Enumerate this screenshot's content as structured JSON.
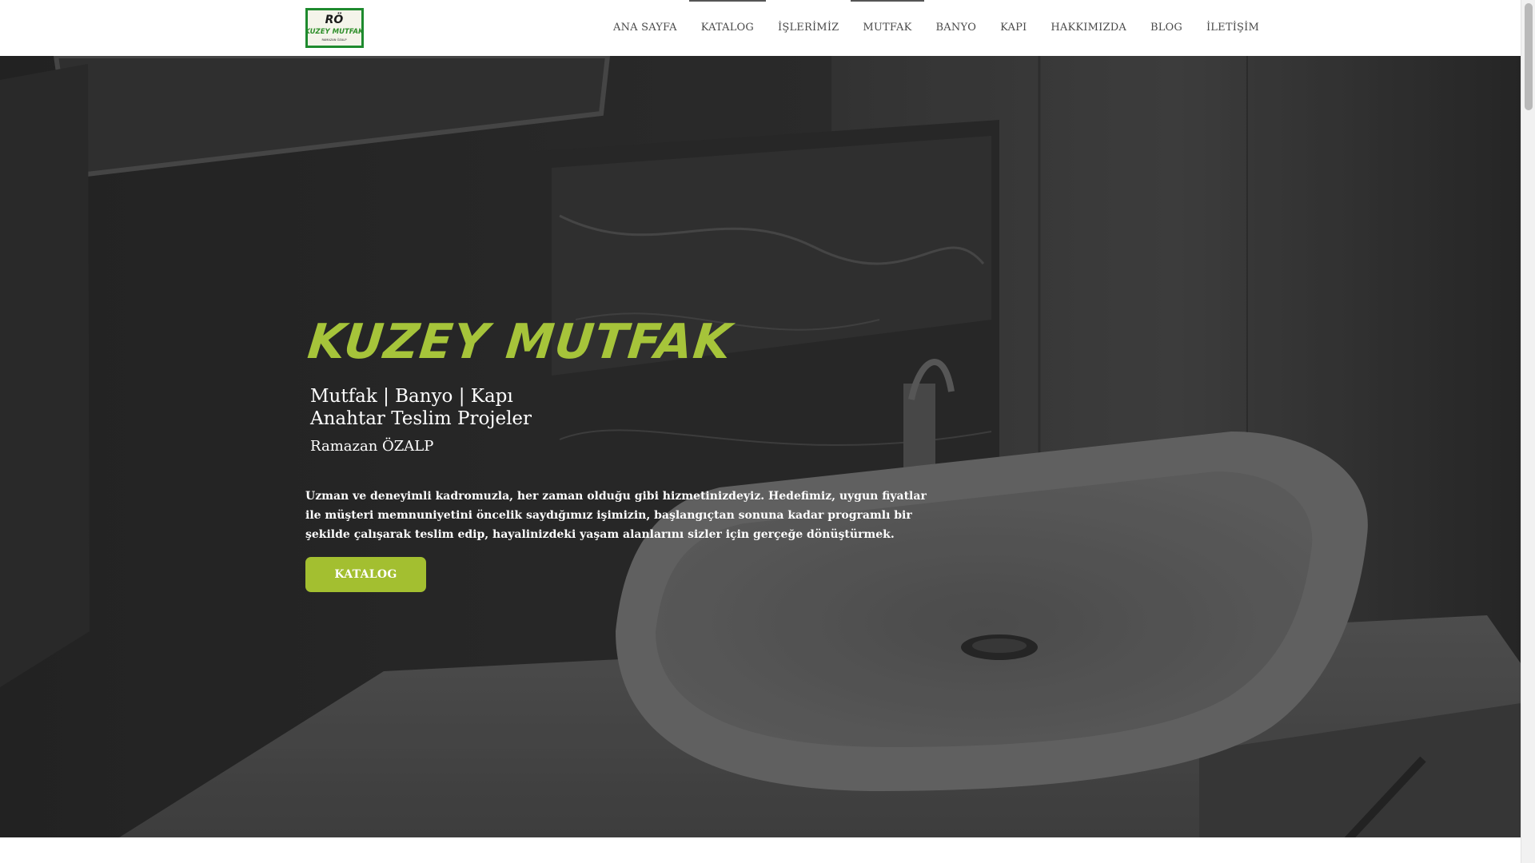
{
  "header": {
    "logo": {
      "line1": "RÖ",
      "line2": "KUZEY MUTFAK",
      "line3": "RAMAZAN ÖZALP"
    },
    "nav": [
      {
        "label": "ANA SAYFA"
      },
      {
        "label": "KATALOG"
      },
      {
        "label": "İŞLERİMİZ"
      },
      {
        "label": "MUTFAK"
      },
      {
        "label": "BANYO"
      },
      {
        "label": "KAPI"
      },
      {
        "label": "HAKKIMIZDA"
      },
      {
        "label": "BLOG"
      },
      {
        "label": "İLETİŞİM"
      }
    ]
  },
  "hero": {
    "brand_title": "KUZEY MUTFAK",
    "services_line1": "Mutfak | Banyo | Kapı",
    "services_line2": "Anahtar Teslim Projeler",
    "owner": "Ramazan ÖZALP",
    "description": "Uzman ve deneyimli kadromuzla, her zaman olduğu gibi hizmetinizdeyiz. Hedefimiz, uygun fiyatlar ile müşteri memnuniyetini öncelik saydığımız işimizin, başlangıçtan sonuna kadar programlı bir şekilde çalışarak teslim edip, hayalinizdeki yaşam alanlarını sizler için gerçeğe dönüştürmek.",
    "cta_label": "KATALOG",
    "background": "bathroom-sink-photo"
  },
  "colors": {
    "accent": "#a6c43a",
    "button": "#a3bf30",
    "logo_border": "#1e8a2e",
    "nav_text": "#4a4a4a"
  }
}
